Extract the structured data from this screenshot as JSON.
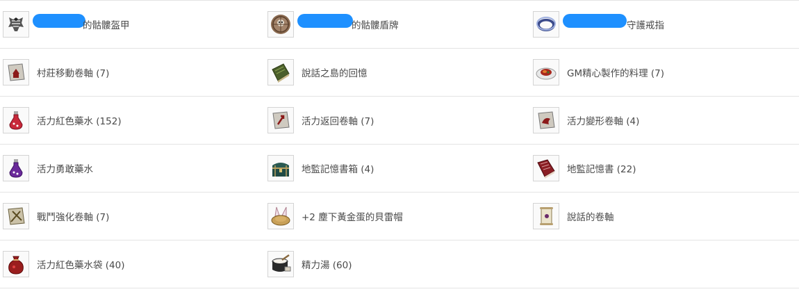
{
  "items": [
    [
      {
        "name": "的骷髏盔甲",
        "icon": "skeleton-armor-icon",
        "redact": 72
      },
      {
        "name": "的骷髏盾牌",
        "icon": "skeleton-shield-icon",
        "redact": 78
      },
      {
        "name": "守護戒指",
        "icon": "ring-icon",
        "redact": 90
      }
    ],
    [
      {
        "name": "村莊移動卷軸 (7)",
        "icon": "village-scroll-icon"
      },
      {
        "name": "說話之島的回憶",
        "icon": "green-book-icon"
      },
      {
        "name": "GM精心製作的料理 (7)",
        "icon": "dish-icon"
      }
    ],
    [
      {
        "name": "活力紅色藥水 (152)",
        "icon": "red-potion-icon"
      },
      {
        "name": "活力返回卷軸 (7)",
        "icon": "return-scroll-icon"
      },
      {
        "name": "活力變形卷軸 (4)",
        "icon": "polymorph-scroll-icon"
      }
    ],
    [
      {
        "name": "活力勇敢藥水",
        "icon": "purple-potion-icon"
      },
      {
        "name": "地監記憶書箱 (4)",
        "icon": "treasure-chest-icon"
      },
      {
        "name": "地監記憶書 (22)",
        "icon": "red-book-icon"
      }
    ],
    [
      {
        "name": "戰鬥強化卷軸 (7)",
        "icon": "battle-scroll-icon"
      },
      {
        "name": "+2 塵下黃金蛋的貝雷帽",
        "icon": "bunny-hat-icon"
      },
      {
        "name": "說話的卷軸",
        "icon": "talking-scroll-icon"
      }
    ],
    [
      {
        "name": "活力紅色藥水袋 (40)",
        "icon": "potion-bag-icon"
      },
      {
        "name": "精力湯 (60)",
        "icon": "soup-pot-icon"
      }
    ]
  ]
}
